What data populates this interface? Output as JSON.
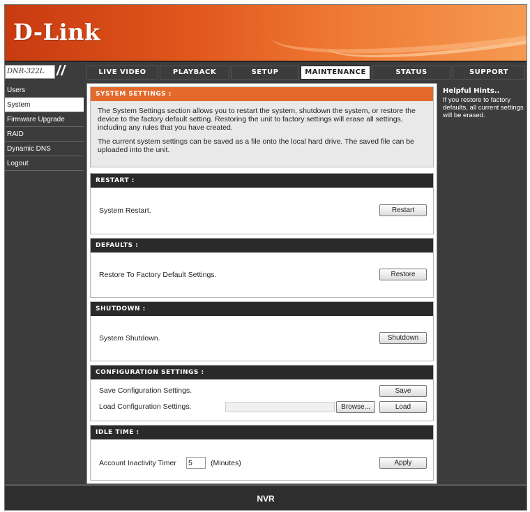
{
  "brand": {
    "logo_text": "D-Link",
    "model": "DNR-322L",
    "accent": "#e36a2b"
  },
  "nav": {
    "tabs": [
      {
        "label": "LIVE VIDEO"
      },
      {
        "label": "PLAYBACK"
      },
      {
        "label": "SETUP"
      },
      {
        "label": "MAINTENANCE"
      },
      {
        "label": "STATUS"
      },
      {
        "label": "SUPPORT"
      }
    ],
    "active_tab": "MAINTENANCE"
  },
  "sidebar": {
    "items": [
      {
        "label": "Users"
      },
      {
        "label": "System"
      },
      {
        "label": "Firmware Upgrade"
      },
      {
        "label": "RAID"
      },
      {
        "label": "Dynamic DNS"
      },
      {
        "label": "Logout"
      }
    ],
    "active_item": "System"
  },
  "intro": {
    "title": "SYSTEM SETTINGS :",
    "para1": "The System Settings section allows you to restart the system, shutdown the system, or restore the device to the factory default setting. Restoring the unit to factory settings will erase all settings, including any rules that you have created.",
    "para2": "The current system settings can be saved as a file onto the local hard drive. The saved file can be uploaded into the unit."
  },
  "restart": {
    "title": "RESTART :",
    "label": "System Restart.",
    "button": "Restart"
  },
  "defaults": {
    "title": "DEFAULTS :",
    "label": "Restore To Factory Default Settings.",
    "button": "Restore"
  },
  "shutdown": {
    "title": "SHUTDOWN :",
    "label": "System Shutdown.",
    "button": "Shutdown"
  },
  "config": {
    "title": "CONFIGURATION SETTINGS :",
    "save_label": "Save Configuration Settings.",
    "save_button": "Save",
    "load_label": "Load Configuration Settings.",
    "browse_button": "Browse...",
    "load_button": "Load"
  },
  "idle": {
    "title": "IDLE TIME :",
    "label": "Account Inactivity Timer",
    "value": "5",
    "unit": "(Minutes)",
    "button": "Apply"
  },
  "hints": {
    "title": "Helpful Hints..",
    "body": "If you restore to factory defaults, all current settings will be erased."
  },
  "footer": {
    "text": "NVR"
  }
}
